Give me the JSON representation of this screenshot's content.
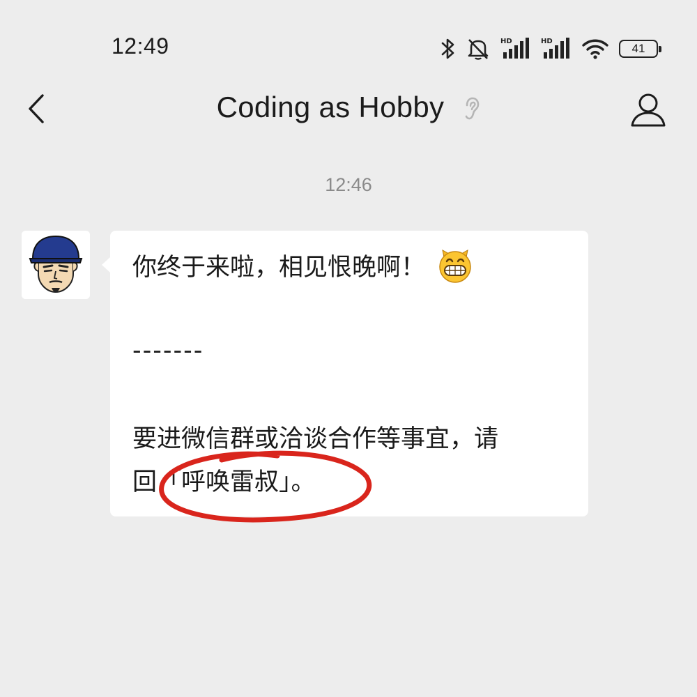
{
  "status_bar": {
    "time": "12:49",
    "battery_level": "41",
    "icons": [
      "bluetooth-icon",
      "muted-bell-icon",
      "hd-signal-icon",
      "hd-signal-icon",
      "wifi-icon",
      "battery-icon"
    ]
  },
  "header": {
    "title": "Coding as Hobby",
    "back_icon": "chevron-left-icon",
    "ear_icon": "ear-icon",
    "profile_icon": "person-icon"
  },
  "chat": {
    "time_separator": "12:46",
    "message": {
      "line1": "你终于来啦，相见恨晚啊！",
      "line1_emoji": "grinning-face-emoji",
      "line2": "-------",
      "line3": "要进微信群或洽谈合作等事宜，请",
      "line4": "回「呼唤雷叔」。"
    },
    "annotation_color": "#d9251c"
  },
  "colors": {
    "background": "#ededed",
    "bubble": "#ffffff",
    "text": "#1a1a1a",
    "muted_text": "#8a8a8a",
    "annotation": "#d9251c"
  }
}
